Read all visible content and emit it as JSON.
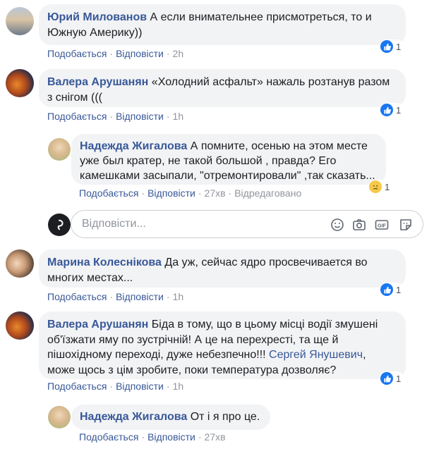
{
  "actions": {
    "like": "Подобається",
    "reply": "Відповісти",
    "edited": "Відредаговано"
  },
  "reply_box": {
    "placeholder": "Відповісти..."
  },
  "colors": {
    "link": "#385898",
    "bubble": "#f2f3f5",
    "meta": "#90949c",
    "like": "#1877f2"
  },
  "comments": [
    {
      "author": "Юрий Милованов",
      "text_1": "А если внимательнее присмотреться, то и",
      "text_2": "Южную Америку))",
      "time": "2h",
      "reactions": "1",
      "reaction_icon": "like-icon"
    },
    {
      "author": "Валера Арушанян",
      "text_1": "«Холодний асфальт» нажаль розтанув разом",
      "text_2": "з снігом (((",
      "time": "1h",
      "reactions": "1",
      "reaction_icon": "like-icon"
    },
    {
      "author": "Надежда Жигалова",
      "text_1": "А помните, осенью на этом месте",
      "text_2": "уже был кратер, не такой большой , правда? Его",
      "text_3": "камешками засыпали, \"отремонтировали\" ,так сказать...",
      "time": "27хв",
      "reactions": "1",
      "reaction_icon": "sad-icon"
    },
    {
      "author": "Марина Колеснікова",
      "text_1": "Да уж, сейчас ядро просвечивается во",
      "text_2": "многих местах...",
      "time": "1h",
      "reactions": "1",
      "reaction_icon": "like-icon"
    },
    {
      "author": "Валера Арушанян",
      "text_1": "Біда в тому, що в цьому місці водії змушені",
      "text_2": "об'їзжати яму по зустрічній! А це на перехресті, та ще й",
      "text_3": "пішохідному переході, дуже небезпечно!!! ",
      "mention": "Сергей Янушевич",
      "text_3b": ",",
      "text_4": "може щось з цім зробите, поки температура дозволяє?",
      "time": "1h",
      "reactions": "1",
      "reaction_icon": "like-icon"
    },
    {
      "author": "Надежда Жигалова",
      "text_1": "От і я про це.",
      "time": "27хв"
    }
  ]
}
